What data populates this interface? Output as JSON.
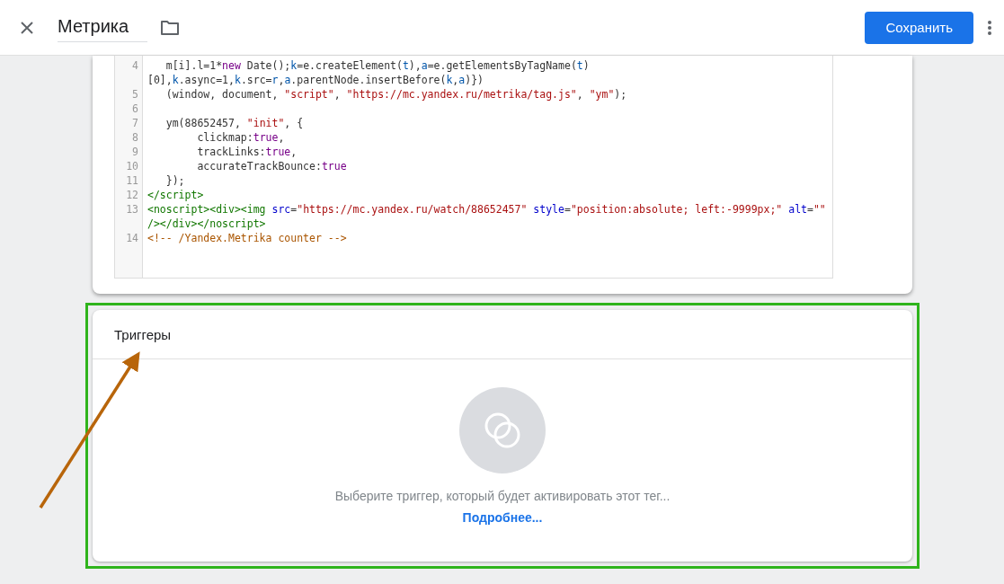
{
  "header": {
    "title": "Метрика",
    "save_button": "Сохранить"
  },
  "editor": {
    "lines": [
      {
        "number": "4",
        "tokens": [
          {
            "kind": "plain",
            "text": "   m[i].l=1*"
          },
          {
            "kind": "keyword",
            "text": "new"
          },
          {
            "kind": "plain",
            "text": " Date();"
          },
          {
            "kind": "var",
            "text": "k"
          },
          {
            "kind": "plain",
            "text": "=e.createElement("
          },
          {
            "kind": "var",
            "text": "t"
          },
          {
            "kind": "plain",
            "text": "),"
          },
          {
            "kind": "var",
            "text": "a"
          },
          {
            "kind": "plain",
            "text": "=e.getElementsByTagName("
          },
          {
            "kind": "var",
            "text": "t"
          },
          {
            "kind": "plain",
            "text": ")"
          }
        ]
      },
      {
        "tokens": [
          {
            "kind": "plain",
            "text": "[0],"
          },
          {
            "kind": "var",
            "text": "k"
          },
          {
            "kind": "plain",
            "text": ".async=1,"
          },
          {
            "kind": "var",
            "text": "k"
          },
          {
            "kind": "plain",
            "text": ".src="
          },
          {
            "kind": "var",
            "text": "r"
          },
          {
            "kind": "plain",
            "text": ","
          },
          {
            "kind": "var",
            "text": "a"
          },
          {
            "kind": "plain",
            "text": ".parentNode.insertBefore("
          },
          {
            "kind": "var",
            "text": "k"
          },
          {
            "kind": "plain",
            "text": ","
          },
          {
            "kind": "var",
            "text": "a"
          },
          {
            "kind": "plain",
            "text": ")})"
          }
        ]
      },
      {
        "number": "5",
        "tokens": [
          {
            "kind": "plain",
            "text": "   (window, document, "
          },
          {
            "kind": "string",
            "text": "\"script\""
          },
          {
            "kind": "plain",
            "text": ", "
          },
          {
            "kind": "string",
            "text": "\"https://mc.yandex.ru/metrika/tag.js\""
          },
          {
            "kind": "plain",
            "text": ", "
          },
          {
            "kind": "string",
            "text": "\"ym\""
          },
          {
            "kind": "plain",
            "text": ");"
          }
        ]
      },
      {
        "number": "6"
      },
      {
        "number": "7",
        "tokens": [
          {
            "kind": "plain",
            "text": "   ym(88652457, "
          },
          {
            "kind": "string",
            "text": "\"init\""
          },
          {
            "kind": "plain",
            "text": ", {"
          }
        ]
      },
      {
        "number": "8",
        "tokens": [
          {
            "kind": "plain",
            "text": "        clickmap:"
          },
          {
            "kind": "keyword",
            "text": "true"
          },
          {
            "kind": "plain",
            "text": ","
          }
        ]
      },
      {
        "number": "9",
        "tokens": [
          {
            "kind": "plain",
            "text": "        trackLinks:"
          },
          {
            "kind": "keyword",
            "text": "true"
          },
          {
            "kind": "plain",
            "text": ","
          }
        ]
      },
      {
        "number": "10",
        "tokens": [
          {
            "kind": "plain",
            "text": "        accurateTrackBounce:"
          },
          {
            "kind": "keyword",
            "text": "true"
          }
        ]
      },
      {
        "number": "11",
        "tokens": [
          {
            "kind": "plain",
            "text": "   });"
          }
        ]
      },
      {
        "number": "12",
        "tokens": [
          {
            "kind": "tag",
            "text": "</script>"
          }
        ]
      },
      {
        "number": "13",
        "tokens": [
          {
            "kind": "tag",
            "text": "<noscript><div><img "
          },
          {
            "kind": "attr",
            "text": "src"
          },
          {
            "kind": "plain",
            "text": "="
          },
          {
            "kind": "string",
            "text": "\"https://mc.yandex.ru/watch/88652457\" "
          },
          {
            "kind": "attr",
            "text": "style"
          },
          {
            "kind": "plain",
            "text": "="
          },
          {
            "kind": "string",
            "text": "\"position:absolute; left:-9999px;\" "
          },
          {
            "kind": "attr",
            "text": "alt"
          },
          {
            "kind": "plain",
            "text": "="
          },
          {
            "kind": "string",
            "text": "\"\""
          }
        ]
      },
      {
        "tokens": [
          {
            "kind": "tag",
            "text": "/></div></noscript>"
          }
        ]
      },
      {
        "number": "14",
        "tokens": [
          {
            "kind": "comment",
            "text": "<!-- /Yandex.Metrika counter -->"
          }
        ]
      }
    ]
  },
  "triggers": {
    "title": "Триггеры",
    "empty_text": "Выберите триггер, который будет активировать этот тег...",
    "link": "Подробнее..."
  }
}
